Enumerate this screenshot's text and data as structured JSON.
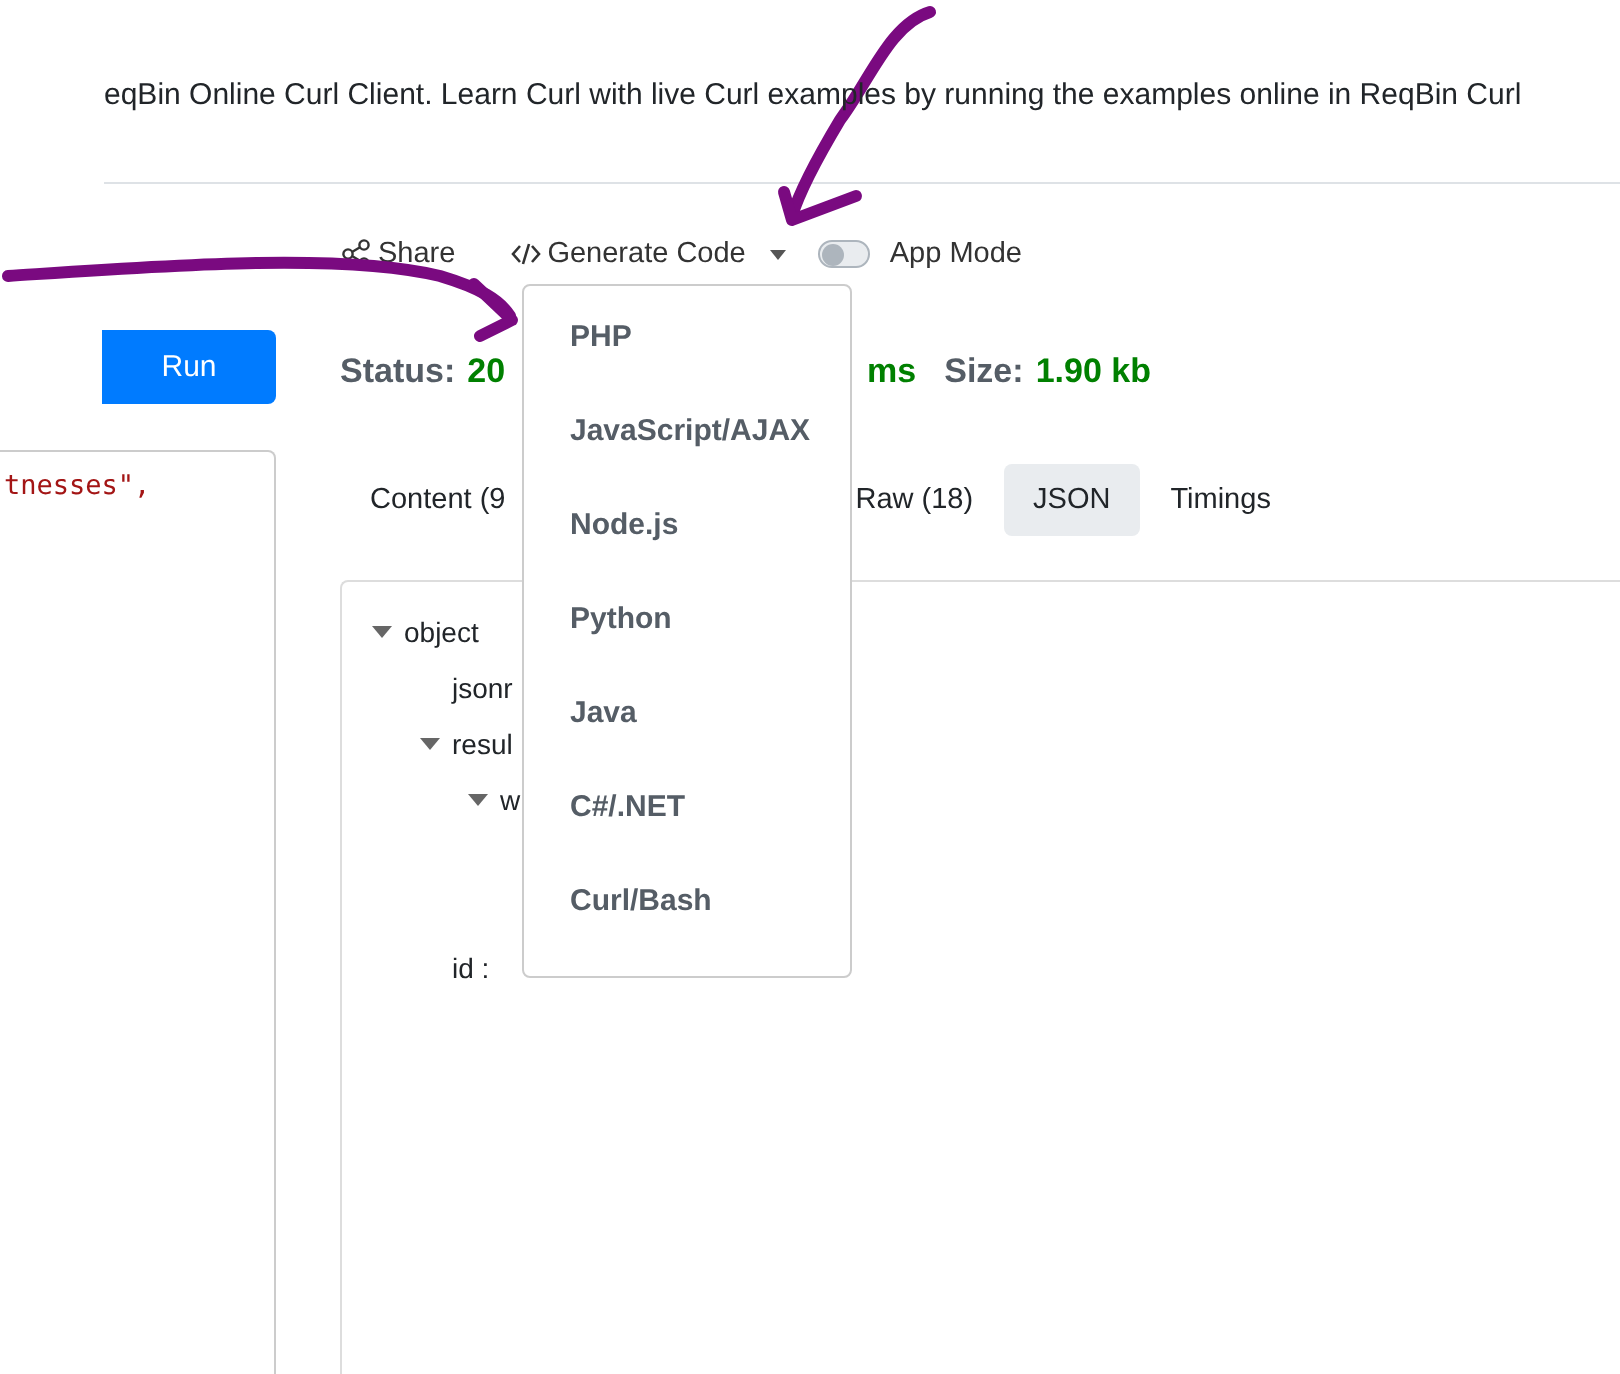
{
  "intro": "eqBin Online Curl Client. Learn Curl with live Curl examples by running the examples online in ReqBin Curl",
  "toolbar": {
    "share": "Share",
    "generate": "Generate Code",
    "app_mode": {
      "label": "App Mode",
      "on": false
    }
  },
  "run_button": "Run",
  "editor_line": "tnesses\",",
  "status": {
    "label": "Status:",
    "code": "20",
    "time_unit": "ms",
    "size_label": "Size:",
    "size": "1.90 kb"
  },
  "tabs": [
    {
      "label": "Content (9",
      "selected": false
    },
    {
      "label": "Raw (18)",
      "selected": false
    },
    {
      "label": "JSON",
      "selected": true
    },
    {
      "label": "Timings",
      "selected": false
    }
  ],
  "tree": [
    {
      "key": "object",
      "expanded": true,
      "children": [
        {
          "key": "jsonr"
        },
        {
          "key": "resul",
          "expanded": true,
          "children": [
            {
              "key": "w",
              "expanded": true
            }
          ]
        },
        {
          "key": "id :"
        }
      ]
    }
  ],
  "dropdown": {
    "items": [
      "PHP",
      "JavaScript/AJAX",
      "Node.js",
      "Python",
      "Java",
      "C#/.NET",
      "Curl/Bash"
    ]
  }
}
